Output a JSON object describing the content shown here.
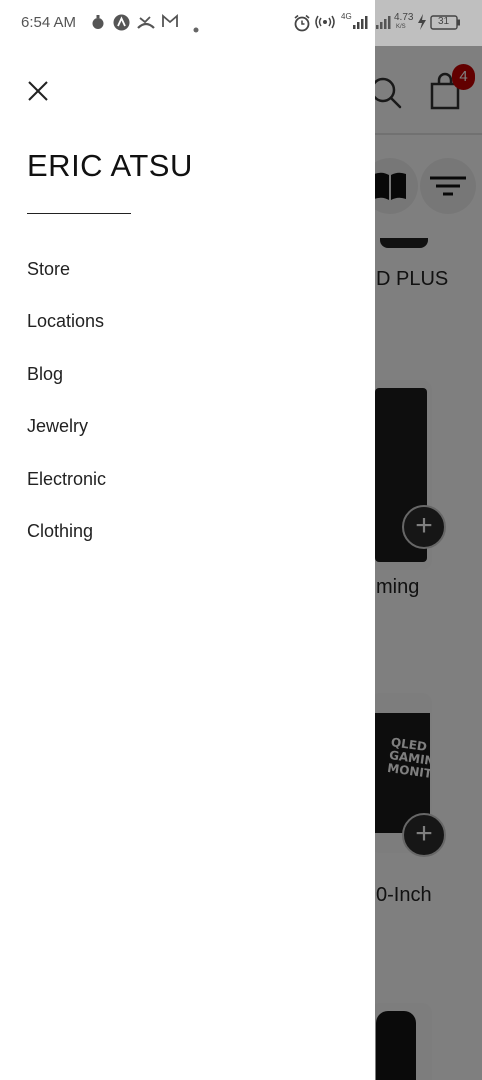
{
  "status_bar": {
    "time": "6:54 AM",
    "network_speed": "4.73",
    "network_speed_unit": "K/S",
    "network_type": "4G",
    "battery": "31"
  },
  "drawer": {
    "user_name": "ERIC ATSU",
    "menu_items": [
      {
        "label": "Store"
      },
      {
        "label": "Locations"
      },
      {
        "label": "Blog"
      },
      {
        "label": "Jewelry"
      },
      {
        "label": "Electronic"
      },
      {
        "label": "Clothing"
      }
    ]
  },
  "background_page": {
    "cart_count": "4",
    "products": [
      {
        "title_fragment": "D PLUS"
      },
      {
        "title_fragment": "ming"
      },
      {
        "title_fragment": "0-Inch"
      }
    ],
    "monitor_text": "QLED GAMING MONITOR"
  },
  "colors": {
    "badge": "#c40000",
    "overlay": "rgba(0,0,0,0.5)",
    "drawer_bg": "#ffffff"
  }
}
